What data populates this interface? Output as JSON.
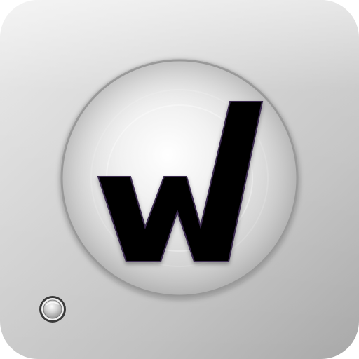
{
  "icon": {
    "semantic": "w-checkmark-logo-icon",
    "logo_text": "w",
    "colors": {
      "tile_light": "#d9d9d9",
      "tile_mid": "#c7c7c7",
      "tile_dark": "#a9a9a9",
      "lens_light": "#f6f6f6",
      "lens_mid": "#e0e0e0",
      "lens_dark": "#bcbcbc",
      "glyph": "#050505",
      "glyph_glow": "#7a3b8f",
      "button_metal": "#bfbfbf",
      "button_ring": "#2e2e2e"
    }
  }
}
